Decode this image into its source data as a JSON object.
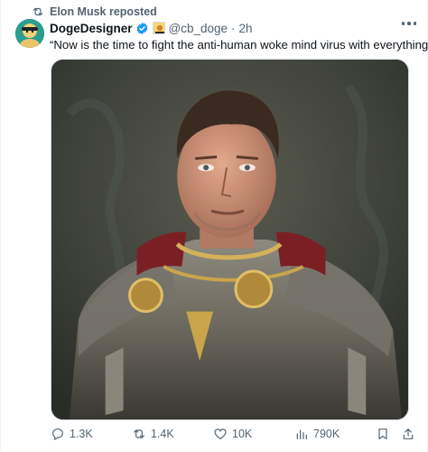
{
  "repost": {
    "label": "Elon Musk reposted",
    "icon": "repost-icon"
  },
  "author": {
    "display_name": "DogeDesigner",
    "verified_icon": "verified-badge-icon",
    "affiliate_icon": "affiliate-badge-icon",
    "handle": "@cb_doge",
    "separator": "·",
    "time": "2h"
  },
  "tweet": {
    "text": "“Now is the time to fight the anti-human woke mind virus with everything!”"
  },
  "media": {
    "icon": "roman-armor-portrait-image"
  },
  "actions": {
    "replies": "1.3K",
    "reposts": "1.4K",
    "likes": "10K",
    "views": "790K"
  },
  "colors": {
    "accent": "#1d9bf0",
    "muted": "#536471",
    "text": "#0f1419"
  }
}
